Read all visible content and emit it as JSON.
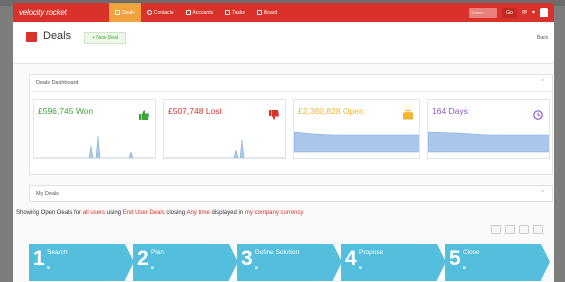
{
  "nav": {
    "brand": "velocity rocket",
    "items": [
      {
        "label": "Deals",
        "icon": "briefcase-icon",
        "active": true
      },
      {
        "label": "Contacts",
        "icon": "contacts-icon",
        "active": false
      },
      {
        "label": "Accounts",
        "icon": "building-icon",
        "active": false
      },
      {
        "label": "Tasks",
        "icon": "check-icon",
        "active": false
      },
      {
        "label": "Board",
        "icon": "board-icon",
        "active": false
      }
    ],
    "search_placeholder": "Search...",
    "search_button": "Go",
    "colors": {
      "bar": "#d9322a",
      "active": "#f2a13f"
    }
  },
  "header": {
    "title": "Deals",
    "new_button": "+ New Deal",
    "right_link": "Back"
  },
  "dashboard": {
    "title": "Deals Dashboard",
    "kpis": [
      {
        "value": "£596,745 Won",
        "color": "#3fa63a",
        "icon": "thumbs-up-icon"
      },
      {
        "value": "£507,748 Lost",
        "color": "#d9322a",
        "icon": "thumbs-down-icon"
      },
      {
        "value": "£2,380,828 Open",
        "color": "#f2b632",
        "icon": "briefcase-icon"
      },
      {
        "value": "164 Days",
        "color": "#8b58c7",
        "icon": "clock-icon"
      }
    ]
  },
  "my_deals": {
    "title": "My Deals",
    "filter": {
      "p1": "Showing Open Deals for ",
      "v1": "all users",
      "p2": " using ",
      "v2": "End User Deals",
      "p3": " closing ",
      "v3": "Any time",
      "p4": " displayed in ",
      "v4": "my company currency"
    },
    "stages": [
      {
        "num": "1",
        "name": "Search"
      },
      {
        "num": "2",
        "name": "Plan"
      },
      {
        "num": "3",
        "name": "Define Solution"
      },
      {
        "num": "4",
        "name": "Propose"
      },
      {
        "num": "5",
        "name": "Close"
      }
    ],
    "stage_color": "#54bfdd"
  }
}
